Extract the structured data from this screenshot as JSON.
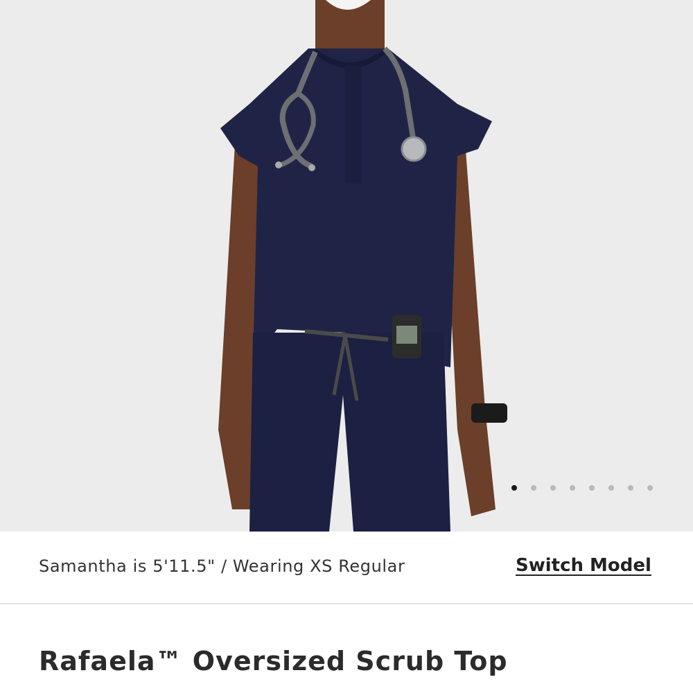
{
  "gallery": {
    "image_alt": "Model wearing navy Rafaela Oversized Scrub Top with stethoscope",
    "dot_count": 8,
    "active_index": 0,
    "colors": {
      "background": "#ececec",
      "garment": "#1f2447",
      "skin": "#6b3f2a",
      "active_dot": "#1a1a1a",
      "inactive_dot": "#b9b9b9"
    }
  },
  "model_info": {
    "text": "Samantha is 5'11.5\" / Wearing XS Regular",
    "switch_label": "Switch Model"
  },
  "product": {
    "title": "Rafaela™ Oversized Scrub Top"
  }
}
